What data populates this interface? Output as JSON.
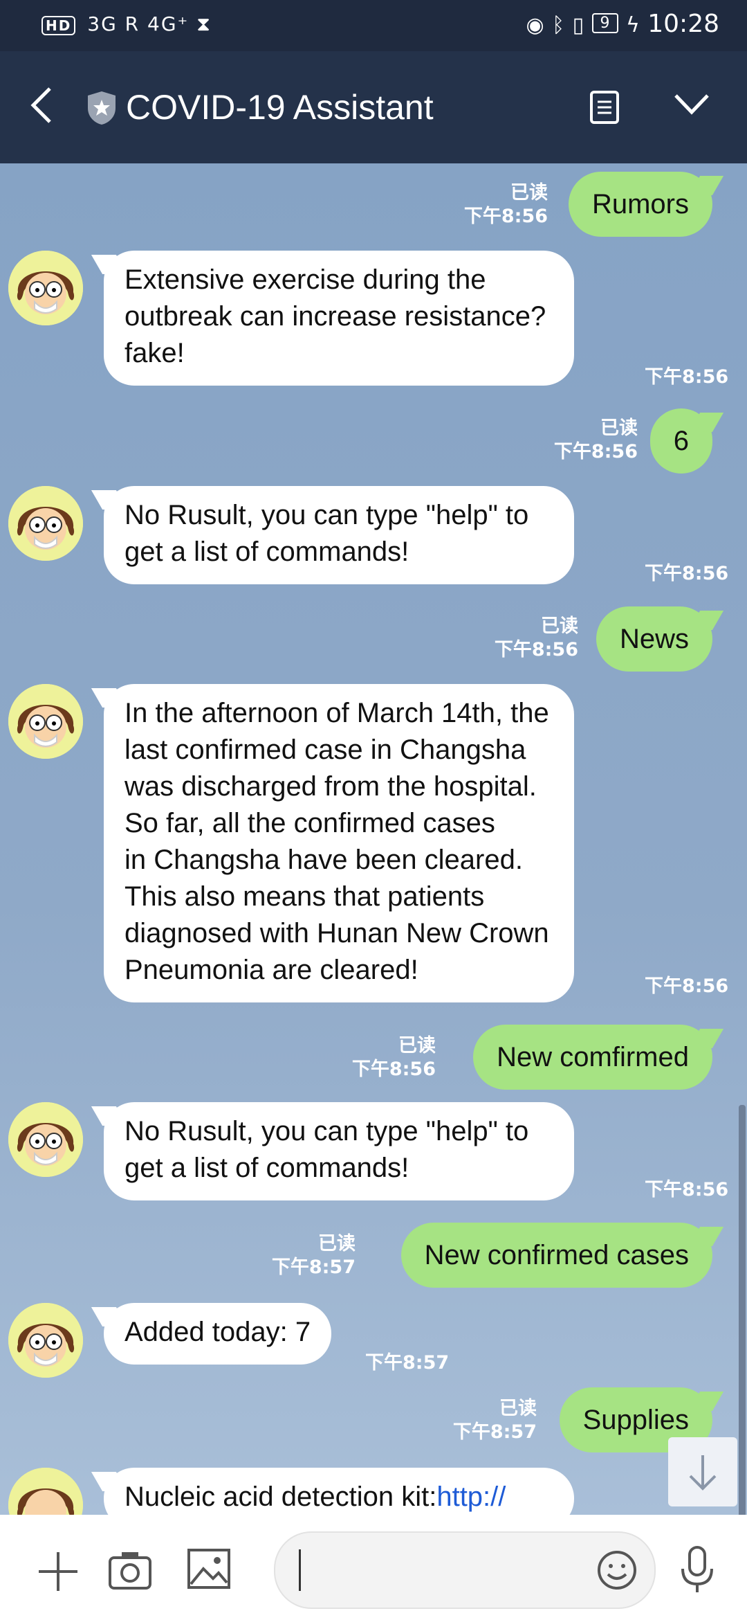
{
  "status_bar": {
    "left_text": "3G R 4G⁺",
    "hd": "HD",
    "battery": "9",
    "time": "10:28"
  },
  "header": {
    "title": "COVID-19 Assistant"
  },
  "icons": {
    "back": "chevron-left-icon",
    "shield": "shield-star-icon",
    "notes": "notes-icon",
    "collapse": "chevron-down-icon"
  },
  "messages": [
    {
      "dir": "out",
      "text": "Rumors",
      "read": "已读",
      "time": "下午8:56"
    },
    {
      "dir": "in",
      "lines": [
        "Extensive exercise during the",
        "outbreak can increase resistance?",
        "fake!"
      ],
      "time": "下午8:56"
    },
    {
      "dir": "out",
      "text": "6",
      "read": "已读",
      "time": "下午8:56"
    },
    {
      "dir": "in",
      "lines": [
        "No Rusult, you can type \"help\" to",
        "get a list of commands!"
      ],
      "time": "下午8:56"
    },
    {
      "dir": "out",
      "text": "News",
      "read": "已读",
      "time": "下午8:56"
    },
    {
      "dir": "in",
      "lines": [
        "In the afternoon of March 14th, the",
        "last confirmed case in Changsha",
        "was discharged from the hospital.",
        "So far, all the confirmed cases",
        "in Changsha have been cleared.",
        "This also means that patients",
        "diagnosed with Hunan New Crown",
        "Pneumonia are cleared!"
      ],
      "time": "下午8:56"
    },
    {
      "dir": "out",
      "text": "New comfirmed",
      "read": "已读",
      "time": "下午8:56"
    },
    {
      "dir": "in",
      "lines": [
        "No Rusult, you can type \"help\" to",
        "get a list of commands!"
      ],
      "time": "下午8:56"
    },
    {
      "dir": "out",
      "text": "New confirmed cases",
      "read": "已读",
      "time": "下午8:57"
    },
    {
      "dir": "in",
      "lines": [
        "Added today: 7"
      ],
      "time": "下午8:57"
    },
    {
      "dir": "out",
      "text": "Supplies",
      "read": "已读",
      "time": "下午8:57"
    },
    {
      "dir": "in",
      "lines": [
        "Nucleic acid detection kit:"
      ],
      "link": "http://",
      "time": ""
    }
  ],
  "composer": {
    "placeholder": ""
  }
}
